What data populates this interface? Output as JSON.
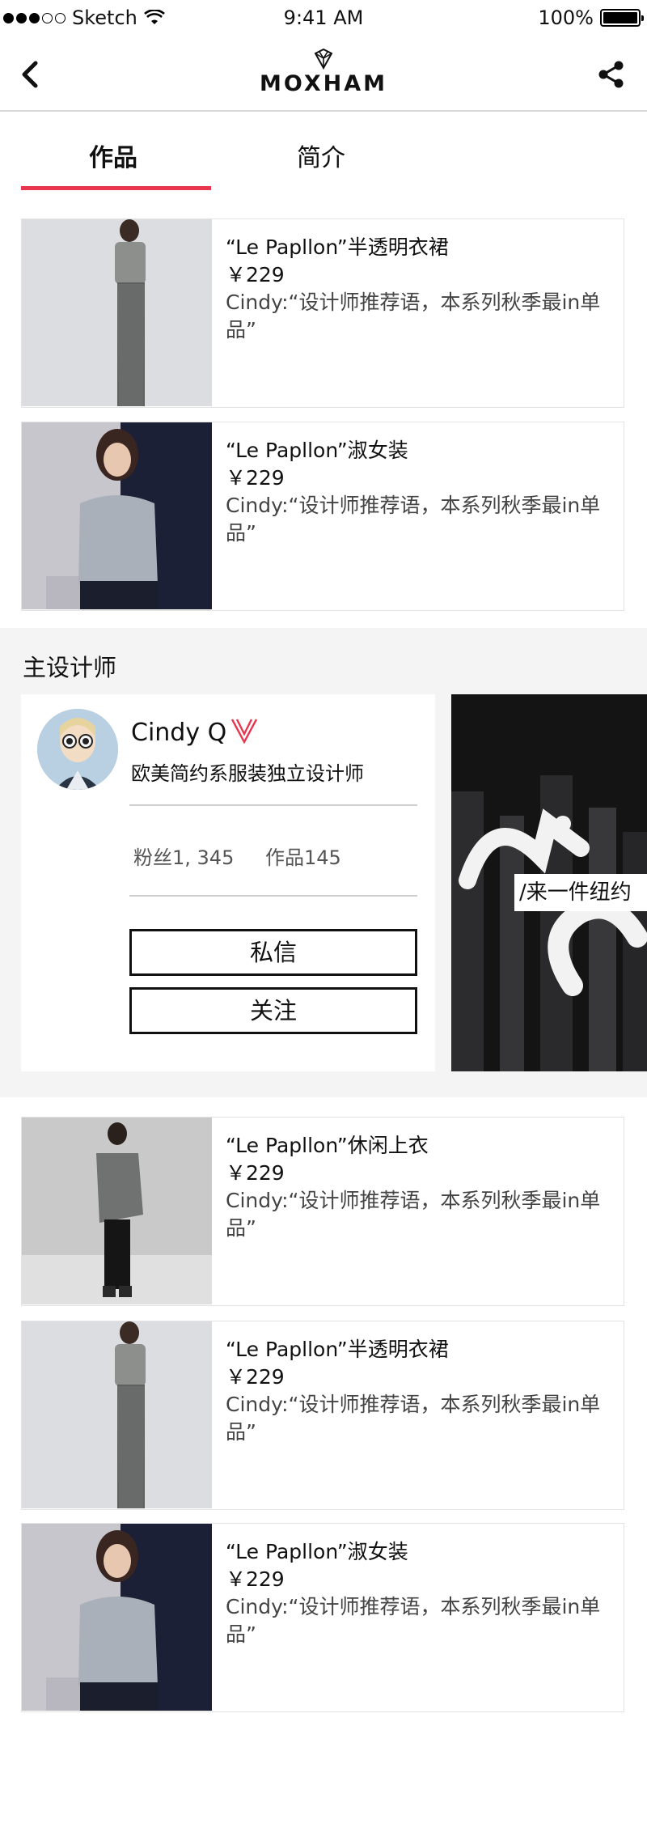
{
  "status_bar": {
    "carrier": "Sketch",
    "time": "9:41 AM",
    "battery": "100%",
    "signal_icon": "signal-dots-icon",
    "wifi_icon": "wifi-icon",
    "battery_icon": "battery-icon"
  },
  "nav": {
    "brand": "MOXHAM",
    "back_icon": "chevron-left-icon",
    "share_icon": "share-icon",
    "logo_icon": "diamond-logo-icon"
  },
  "tabs": [
    {
      "label": "作品",
      "active": true
    },
    {
      "label": "简介",
      "active": false
    }
  ],
  "accent_color": "#e8364f",
  "products_top": [
    {
      "title": "“Le Papllon”半透明衣裙",
      "price": "￥229",
      "desc": "Cindy:“设计师推荐语，本系列秋季最in单品”"
    },
    {
      "title": "“Le Papllon”淑女装",
      "price": "￥229",
      "desc": "Cindy:“设计师推荐语，本系列秋季最in单品”"
    }
  ],
  "designer_section": {
    "title": "主设计师",
    "name": "Cindy Q",
    "bio": "欧美简约系服装独立设计师",
    "fans": "粉丝1, 345",
    "works": "作品145",
    "message_button": "私信",
    "follow_button": "关注",
    "verified_icon": "verified-v-icon",
    "banner_text": "/来一件纽约"
  },
  "products_bottom": [
    {
      "title": "“Le Papllon”休闲上衣",
      "price": "￥229",
      "desc": "Cindy:“设计师推荐语，本系列秋季最in单品”"
    },
    {
      "title": "“Le Papllon”半透明衣裙",
      "price": "￥229",
      "desc": "Cindy:“设计师推荐语，本系列秋季最in单品”"
    },
    {
      "title": "“Le Papllon”淑女装",
      "price": "￥229",
      "desc": "Cindy:“设计师推荐语，本系列秋季最in单品”"
    }
  ]
}
